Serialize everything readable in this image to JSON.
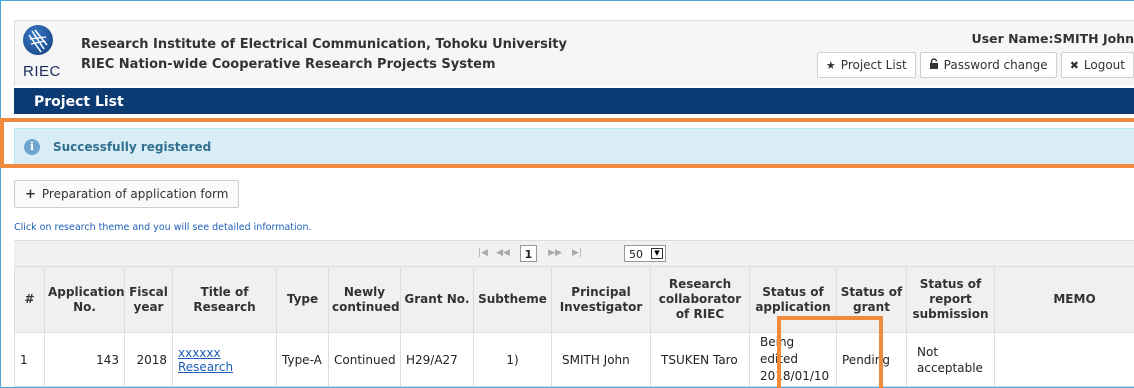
{
  "header": {
    "logo_text": "RIEC",
    "institute": "Research Institute of Electrical Communication, Tohoku University",
    "system": "RIEC Nation-wide Cooperative Research Projects System",
    "user": "User Name:SMITH John",
    "buttons": {
      "project_list": "Project List",
      "password_change": "Password change",
      "logout": "Logout"
    }
  },
  "titlebar": "Project List",
  "alert": "Successfully registered",
  "add_button": "Preparation of application form",
  "hint": "Click on research theme and you will see detailed information.",
  "pager": {
    "first": "|◀",
    "prev": "◀◀",
    "current": "1",
    "next": "▶▶",
    "last": "▶|",
    "page_size": "50"
  },
  "table": {
    "headers": [
      "#",
      "Application No.",
      "Fiscal year",
      "Title of Research",
      "Type",
      "Newly continued",
      "Grant No.",
      "Subtheme",
      "Principal Investigator",
      "Research collaborator of RIEC",
      "Status of application",
      "Status of grant",
      "Status of report submission",
      "MEMO"
    ],
    "rows": [
      {
        "num": "1",
        "app_no": "143",
        "year": "2018",
        "title_line1": "xxxxxx",
        "title_line2": "Research",
        "type": "Type-A",
        "newly": "Continued",
        "grant": "H29/A27",
        "subtheme": "1)",
        "pi": "SMITH John",
        "collab": "TSUKEN Taro",
        "status_app_1": "Being",
        "status_app_2": "edited",
        "status_app_3": "2018/01/10",
        "status_grant": "Pending",
        "report_1": "Not",
        "report_2": "acceptable",
        "memo": ""
      }
    ]
  },
  "colors": {
    "titlebar": "#0c3a72",
    "alert_bg": "#d9edf7",
    "alert_text": "#31708f",
    "highlight": "#f08a3c",
    "link": "#1d5fb8"
  }
}
